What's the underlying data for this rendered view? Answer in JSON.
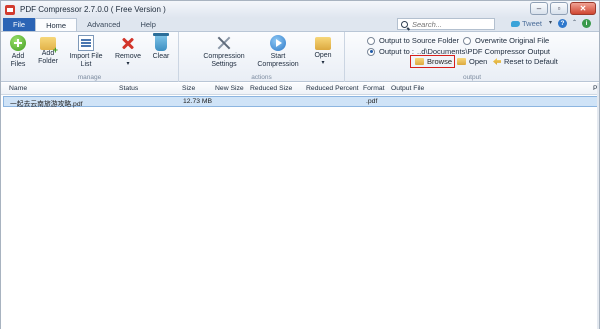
{
  "window": {
    "title": "PDF Compressor 2.7.0.0 ( Free Version )",
    "minimize": "–",
    "maximize": "▫",
    "close": "✕"
  },
  "menu": {
    "file": "File",
    "tabs": [
      "Home",
      "Advanced",
      "Help"
    ]
  },
  "search": {
    "placeholder": "Search..."
  },
  "topright": {
    "tweet": "Tweet",
    "help": "?",
    "info": "i",
    "caret": "▾",
    "minimize_ribbon": "⌃"
  },
  "ribbon": {
    "manage": {
      "label": "manage",
      "add_files": "Add\nFiles",
      "add_folder": "Add\nFolder",
      "import_list": "Import File\nList",
      "remove": "Remove",
      "clear": "Clear"
    },
    "actions": {
      "label": "actions",
      "compression_settings": "Compression\nSettings",
      "start_compression": "Start\nCompression",
      "open": "Open"
    },
    "output": {
      "label": "output",
      "to_source": "Output to Source Folder",
      "overwrite": "Overwrite Original File",
      "output_to": "Output to :",
      "path": "..d\\Documents\\PDF Compressor Output",
      "browse": "Browse",
      "open": "Open",
      "reset": "Reset to Default"
    }
  },
  "table": {
    "columns": [
      "Name",
      "Status",
      "Size",
      "New Size",
      "Reduced Size",
      "Reduced Percent",
      "Format",
      "Output File"
    ],
    "last_col_marker": "P",
    "rows": [
      {
        "name": "一起去云南旅游攻略.pdf",
        "status": "",
        "size": "12.73 MB",
        "new_size": "",
        "reduced_size": "",
        "reduced_percent": "",
        "format": ".pdf",
        "output_file": ""
      }
    ]
  }
}
